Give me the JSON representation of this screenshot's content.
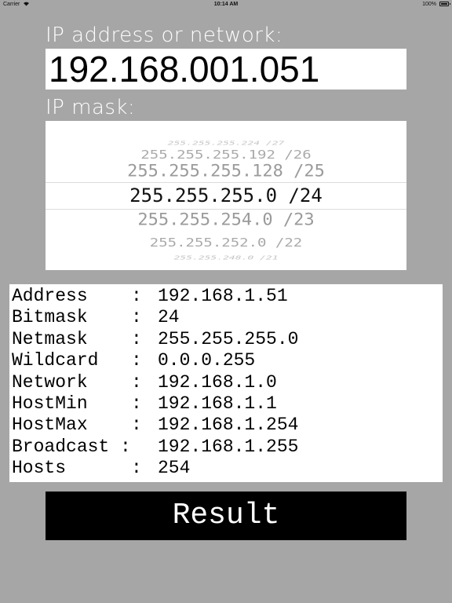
{
  "status_bar": {
    "carrier": "Carrier",
    "wifi_icon": "wifi-icon",
    "time": "10:14 AM",
    "battery_percent": "100%",
    "battery_icon": "battery-full-icon"
  },
  "ip_section": {
    "label": "IP address or network:",
    "value": "192.168.001.051"
  },
  "mask_section": {
    "label": "IP mask:",
    "picker_options": [
      "255.255.255.224 /27",
      "255.255.255.192 /26",
      "255.255.255.128 /25",
      "255.255.255.0 /24",
      "255.255.254.0 /23",
      "255.255.252.0 /22",
      "255.255.248.0 /21"
    ],
    "selected_index": 3
  },
  "results": [
    {
      "key": "Address",
      "sep": ":",
      "value": "192.168.1.51"
    },
    {
      "key": "Bitmask",
      "sep": ":",
      "value": "24"
    },
    {
      "key": "Netmask",
      "sep": ":",
      "value": "255.255.255.0"
    },
    {
      "key": "Wildcard",
      "sep": ":",
      "value": "0.0.0.255"
    },
    {
      "key": "Network",
      "sep": ":",
      "value": "192.168.1.0"
    },
    {
      "key": "HostMin",
      "sep": ":",
      "value": "192.168.1.1"
    },
    {
      "key": "HostMax",
      "sep": ":",
      "value": "192.168.1.254"
    },
    {
      "key": "Broadcast",
      "sep": ":",
      "value": "192.168.1.255"
    },
    {
      "key": "Hosts",
      "sep": ":",
      "value": "254"
    }
  ],
  "result_button": {
    "label": "Result"
  },
  "colors": {
    "background": "#a6a6a6",
    "panel": "#ffffff",
    "button": "#000000",
    "button_text": "#ffffff"
  }
}
